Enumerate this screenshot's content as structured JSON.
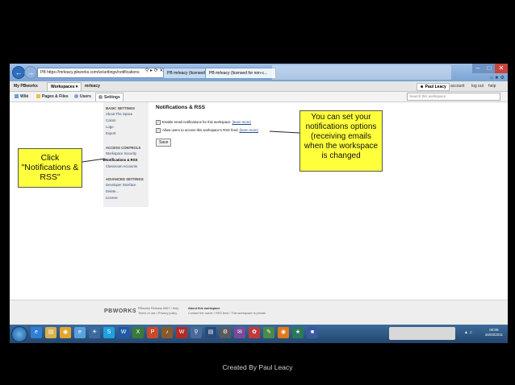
{
  "browser": {
    "address": "PB  https://mrleacy.pbworks.com/w/settings/notifications",
    "tabs": [
      "PB mrleacy (licensed for non-c...",
      "PB mrleacy (licensed for non-c..."
    ],
    "back_icon": "back-arrow-icon",
    "forward_icon": "forward-arrow-icon"
  },
  "pb_header": {
    "my_pbworks": "My PBworks",
    "workspaces": "Workspaces",
    "workspace_name": "mrleacy",
    "user": "Paul Leacy",
    "account": "account",
    "log_out": "log out",
    "help": "help"
  },
  "pb_tabs": {
    "wiki": "Wiki",
    "pages_files": "Pages & Files",
    "users": "Users",
    "settings": "Settings"
  },
  "search_placeholder": "Search this workspace",
  "sidebar": {
    "basic_heading": "BASIC SETTINGS",
    "basic_items": [
      "About The Space",
      "Colors",
      "Logo",
      "Export"
    ],
    "access_heading": "ACCESS CONTROLS",
    "access_items": [
      "Workspace Security",
      "Notifications & RSS",
      "Classroom Accounts"
    ],
    "advanced_heading": "ADVANCED SETTINGS",
    "advanced_items": [
      "Developer Interface",
      "Delete...",
      "License"
    ],
    "current": "Notifications & RSS"
  },
  "content": {
    "title": "Notifications & RSS",
    "option1": "Enable email notifications for this workspace",
    "option2": "Allow users to access this workspace's RSS feed",
    "learn_more": "(learn more)",
    "save": "Save"
  },
  "callouts": {
    "click": "Click \"Notifications & RSS\"",
    "notifications": "You can set your notifications options (receiving emails when the workspace is changed"
  },
  "footer": {
    "logo": "PBWORKS",
    "release": "PBworks Release #567 / Help",
    "terms": "Terms of use / Privacy policy",
    "about_heading": "About this workspace",
    "about_text": "Contact the owner / RSS feed / This workspace is private"
  },
  "taskbar": {
    "time": "00:09",
    "date": "16/03/2011"
  },
  "credit": "Created By Paul Leacy",
  "colors": {
    "callout": "#ffff3c",
    "background": "#000000"
  }
}
